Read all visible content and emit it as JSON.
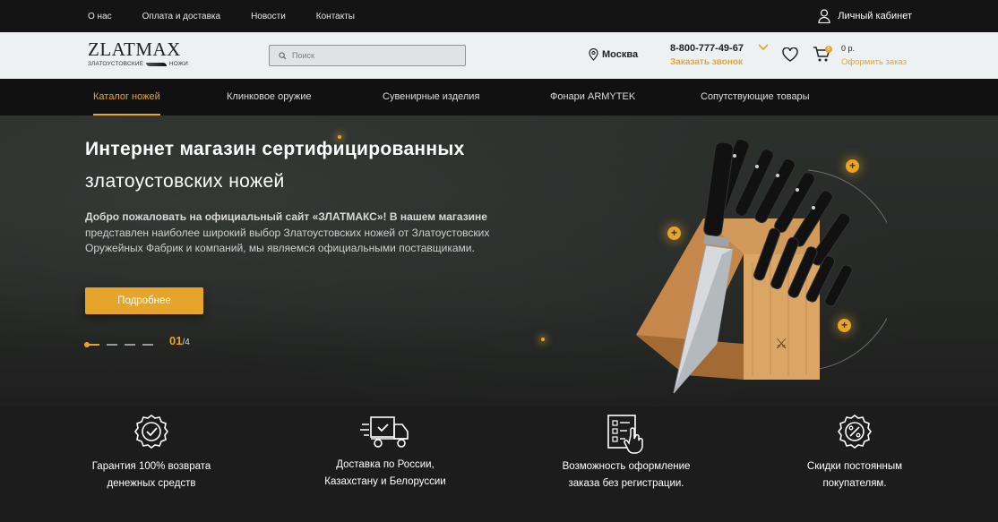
{
  "topbar": {
    "links": [
      "О нас",
      "Оплата и доставка",
      "Новости",
      "Контакты"
    ],
    "account_label": "Личный кабинет",
    "account_icon": "user-icon"
  },
  "header": {
    "logo_text": "ZLATMAX",
    "logo_sub_left": "ЗЛАТОУСТОВСКИЕ",
    "logo_sub_right": "НОЖИ",
    "search_placeholder": "Поиск",
    "city": "Москва",
    "phone": "8-800-777-49-67",
    "callback_label": "Заказать звонок",
    "cart_count": "0",
    "cart_sum": "0 р.",
    "checkout_label": "Оформить заказ"
  },
  "nav": {
    "items": [
      {
        "label": "Каталог ножей",
        "active": true
      },
      {
        "label": "Клинковое оружие",
        "active": false
      },
      {
        "label": "Сувенирные изделия",
        "active": false
      },
      {
        "label": "Фонари ARMYTEK",
        "active": false
      },
      {
        "label": "Сопутствующие товары",
        "active": false
      }
    ]
  },
  "hero": {
    "title": "Интернет магазин сертифицированных",
    "subtitle": "златоустовских ножей",
    "text_bold": "Добро пожаловать на официальный сайт «ЗЛАТМАКС»! В нашем магазине",
    "text_line2": "представлен наиболее широкий выбор Златоустовских ножей от Златоустовских",
    "text_line3": "Оружейных Фабрик и компаний, мы являемся официальными поставщиками.",
    "button_label": "Подробнее",
    "slide_current": "01",
    "slide_total": "/4"
  },
  "features": [
    {
      "label_line1": "Гарантия 100% возврата",
      "label_line2": "денежных средств",
      "icon": "guarantee-badge-icon"
    },
    {
      "label_line1": "Доставка по России,",
      "label_line2": "Казахстану и Белоруссии",
      "icon": "delivery-truck-icon"
    },
    {
      "label_line1": "Возможность оформление",
      "label_line2": "заказа без регистрации.",
      "icon": "checklist-hand-icon"
    },
    {
      "label_line1": "Скидки постоянным",
      "label_line2": "покупателям.",
      "icon": "discount-badge-icon"
    }
  ],
  "colors": {
    "accent": "#e6a52a",
    "header_bg": "#eef1f1",
    "dark_bg": "#141414"
  }
}
